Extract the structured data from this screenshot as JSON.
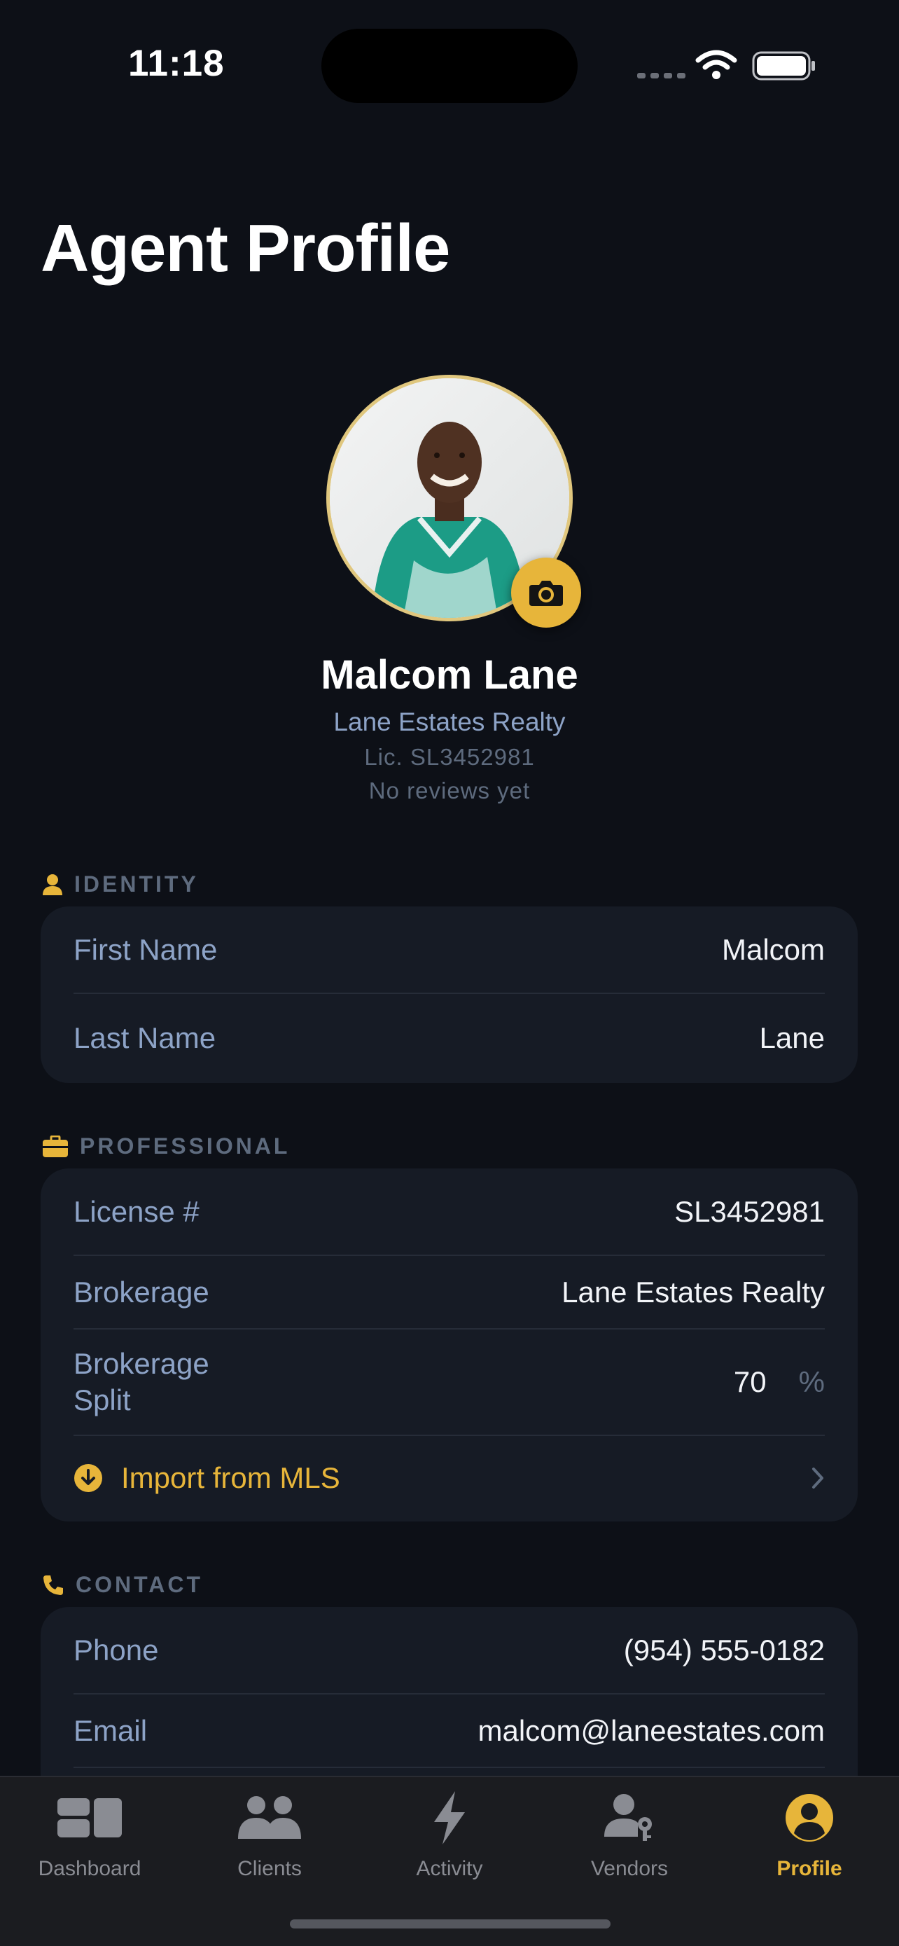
{
  "status_bar": {
    "time": "11:18"
  },
  "header": {
    "title": "Agent Profile"
  },
  "profile": {
    "name": "Malcom Lane",
    "brokerage": "Lane Estates Realty",
    "license": "Lic. SL3452981",
    "reviews": "No reviews yet"
  },
  "identity": {
    "title": "IDENTITY",
    "rows": [
      {
        "label": "First Name",
        "value": "Malcom"
      },
      {
        "label": "Last Name",
        "value": "Lane"
      }
    ]
  },
  "professional": {
    "title": "PROFESSIONAL",
    "license_label": "License #",
    "license_value": "SL3452981",
    "brokerage_label": "Brokerage",
    "brokerage_value": "Lane Estates Realty",
    "split_label": "Brokerage Split",
    "split_value": "70",
    "split_unit": "%",
    "import_label": "Import from MLS"
  },
  "contact": {
    "title": "CONTACT",
    "rows": [
      {
        "label": "Phone",
        "value": "(954) 555-0182"
      },
      {
        "label": "Email",
        "value": "malcom@laneestates.com"
      }
    ]
  },
  "tabbar": {
    "tabs": [
      {
        "label": "Dashboard",
        "icon": "dashboard-icon"
      },
      {
        "label": "Clients",
        "icon": "clients-icon"
      },
      {
        "label": "Activity",
        "icon": "bolt-icon"
      },
      {
        "label": "Vendors",
        "icon": "vendors-icon"
      },
      {
        "label": "Profile",
        "icon": "profile-icon",
        "active": true
      }
    ]
  },
  "colors": {
    "accent": "#e7b53a",
    "background": "#0d1017",
    "card": "#161b25",
    "label": "#8da3c7",
    "muted": "#5e6b7e"
  }
}
